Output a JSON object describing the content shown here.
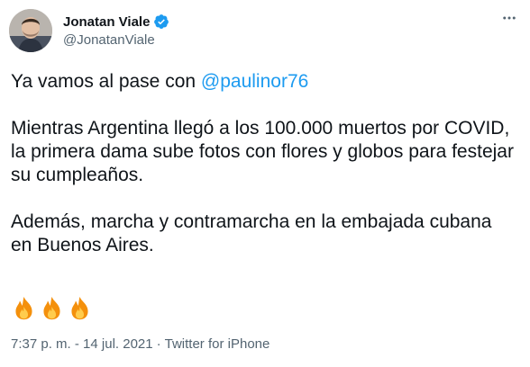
{
  "author": {
    "display_name": "Jonatan Viale",
    "handle": "@JonatanViale",
    "verified": true
  },
  "tweet": {
    "line1_prefix": "Ya vamos al pase con ",
    "mention": "@paulinor76",
    "paragraph2": "Mientras Argentina llegó a los 100.000 muertos por COVID, la primera dama sube fotos con flores y globos para festejar su cumpleaños.",
    "paragraph3": "Además, marcha y contramarcha en la embajada cubana en Buenos Aires.",
    "emojis": [
      "fire-emoji",
      "fire-emoji",
      "fire-emoji"
    ]
  },
  "meta": {
    "time": "7:37 p. m.",
    "separator": "·",
    "date": "14 jul. 2021",
    "source": "Twitter for iPhone"
  },
  "icons": {
    "more": "more-options-icon",
    "verified": "verified-badge-icon"
  },
  "colors": {
    "accent": "#1d9bf0",
    "text": "#0f1419",
    "secondary": "#536471"
  }
}
